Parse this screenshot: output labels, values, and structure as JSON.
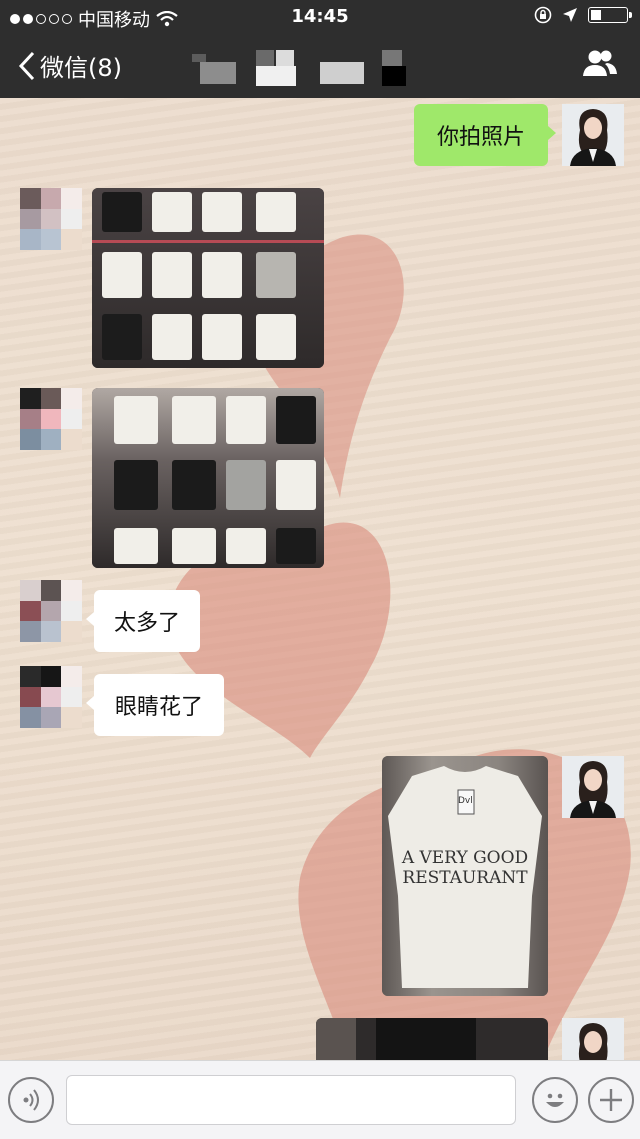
{
  "status_bar": {
    "carrier": "中国移动",
    "time": "14:45",
    "battery_level": 0.3
  },
  "nav": {
    "back_label": "微信(8)",
    "chat_title": "",
    "icons": {
      "back": "chevron-left-icon",
      "group": "group-members-icon"
    }
  },
  "messages": [
    {
      "side": "right",
      "type": "text",
      "text": "你拍照片"
    },
    {
      "side": "left",
      "type": "image",
      "description_icon": "tshirt-rack-photo"
    },
    {
      "side": "left",
      "type": "image",
      "description_icon": "tshirt-rack-photo"
    },
    {
      "side": "left",
      "type": "text",
      "text": "太多了"
    },
    {
      "side": "left",
      "type": "text",
      "text": "眼睛花了"
    },
    {
      "side": "right",
      "type": "image",
      "shirt_text_line1": "A VERY GOOD",
      "shirt_text_line2": "RESTAURANT",
      "tag_text": "Dvl"
    },
    {
      "side": "right",
      "type": "image",
      "description_icon": "dark-shirt-photo"
    }
  ],
  "input_bar": {
    "input_value": "",
    "icons": {
      "voice": "voice-icon",
      "emoji": "emoji-icon",
      "more": "plus-icon"
    }
  },
  "colors": {
    "header_bg": "#2e2e2e",
    "chat_bg": "#ecdccd",
    "sent_bubble": "#9fe86a",
    "received_bubble": "#ffffff",
    "heart": "#d98a7c"
  }
}
